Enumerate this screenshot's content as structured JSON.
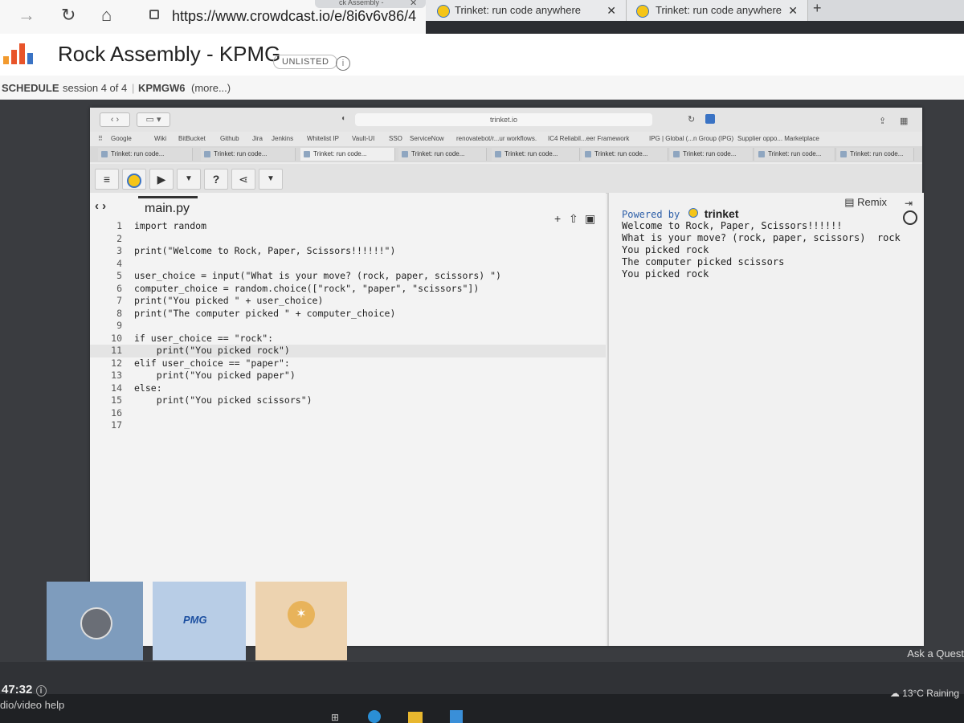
{
  "outer_browser": {
    "tabs": [
      {
        "label": "ck Assembly -"
      },
      {
        "label": "Trinket: run code anywhere"
      },
      {
        "label": "Trinket: run code anywhere"
      }
    ],
    "url": "https://www.crowdcast.io/e/8i6v6v86/4"
  },
  "event": {
    "title": "Rock Assembly - KPMG",
    "badge": "UNLISTED",
    "schedule_label": "SCHEDULE",
    "session": "session 4 of 4",
    "code": "KPMGW6",
    "more": "(more...)"
  },
  "inner_browser": {
    "address": "trinket.io",
    "bookmarks": [
      "Google",
      "Wiki",
      "BitBucket",
      "Github",
      "Jira",
      "Jenkins",
      "Whitelist IP",
      "Vault-UI",
      "SSO",
      "ServiceNow",
      "renovatebot/r...ur workflows.",
      "IC4 Reliabil...eer Framework",
      "IPG | Global (...n Group (IPG)",
      "Supplier oppo... Marketplace"
    ],
    "tabs": [
      "Trinket: run code...",
      "Trinket: run code...",
      "Trinket: run code...",
      "Trinket: run code...",
      "Trinket: run code...",
      "Trinket: run code...",
      "Trinket: run code...",
      "Trinket: run code...",
      "Trinket: run code..."
    ]
  },
  "trinket": {
    "file_tab": "main.py",
    "remix": "Remix",
    "toolbar": {
      "help": "?"
    },
    "code_lines": [
      {
        "n": "1",
        "text": "import random"
      },
      {
        "n": "2",
        "text": ""
      },
      {
        "n": "3",
        "text": "print(\"Welcome to Rock, Paper, Scissors!!!!!!\")"
      },
      {
        "n": "4",
        "text": ""
      },
      {
        "n": "5",
        "text": "user_choice = input(\"What is your move? (rock, paper, scissors) \")"
      },
      {
        "n": "6",
        "text": "computer_choice = random.choice([\"rock\", \"paper\", \"scissors\"])"
      },
      {
        "n": "7",
        "text": "print(\"You picked \" + user_choice)"
      },
      {
        "n": "8",
        "text": "print(\"The computer picked \" + computer_choice)"
      },
      {
        "n": "9",
        "text": ""
      },
      {
        "n": "10",
        "text": "if user_choice == \"rock\":"
      },
      {
        "n": "11",
        "text": "    print(\"You picked rock\")"
      },
      {
        "n": "12",
        "text": "elif user_choice == \"paper\":"
      },
      {
        "n": "13",
        "text": "    print(\"You picked paper\")"
      },
      {
        "n": "14",
        "text": "else:"
      },
      {
        "n": "15",
        "text": "    print(\"You picked scissors\")"
      },
      {
        "n": "16",
        "text": ""
      },
      {
        "n": "17",
        "text": ""
      }
    ],
    "output": {
      "powered_by": "Powered by",
      "brand": "trinket",
      "lines": [
        "Welcome to Rock, Paper, Scissors!!!!!!",
        "What is your move? (rock, paper, scissors)  rock",
        "You picked rock",
        "The computer picked scissors",
        "You picked rock"
      ]
    }
  },
  "participants": {
    "kpmg_label": "PMG"
  },
  "footer": {
    "ask": "Ask a Quest",
    "timer": "47:32",
    "help": "dio/video help",
    "weather": "13°C  Raining"
  }
}
